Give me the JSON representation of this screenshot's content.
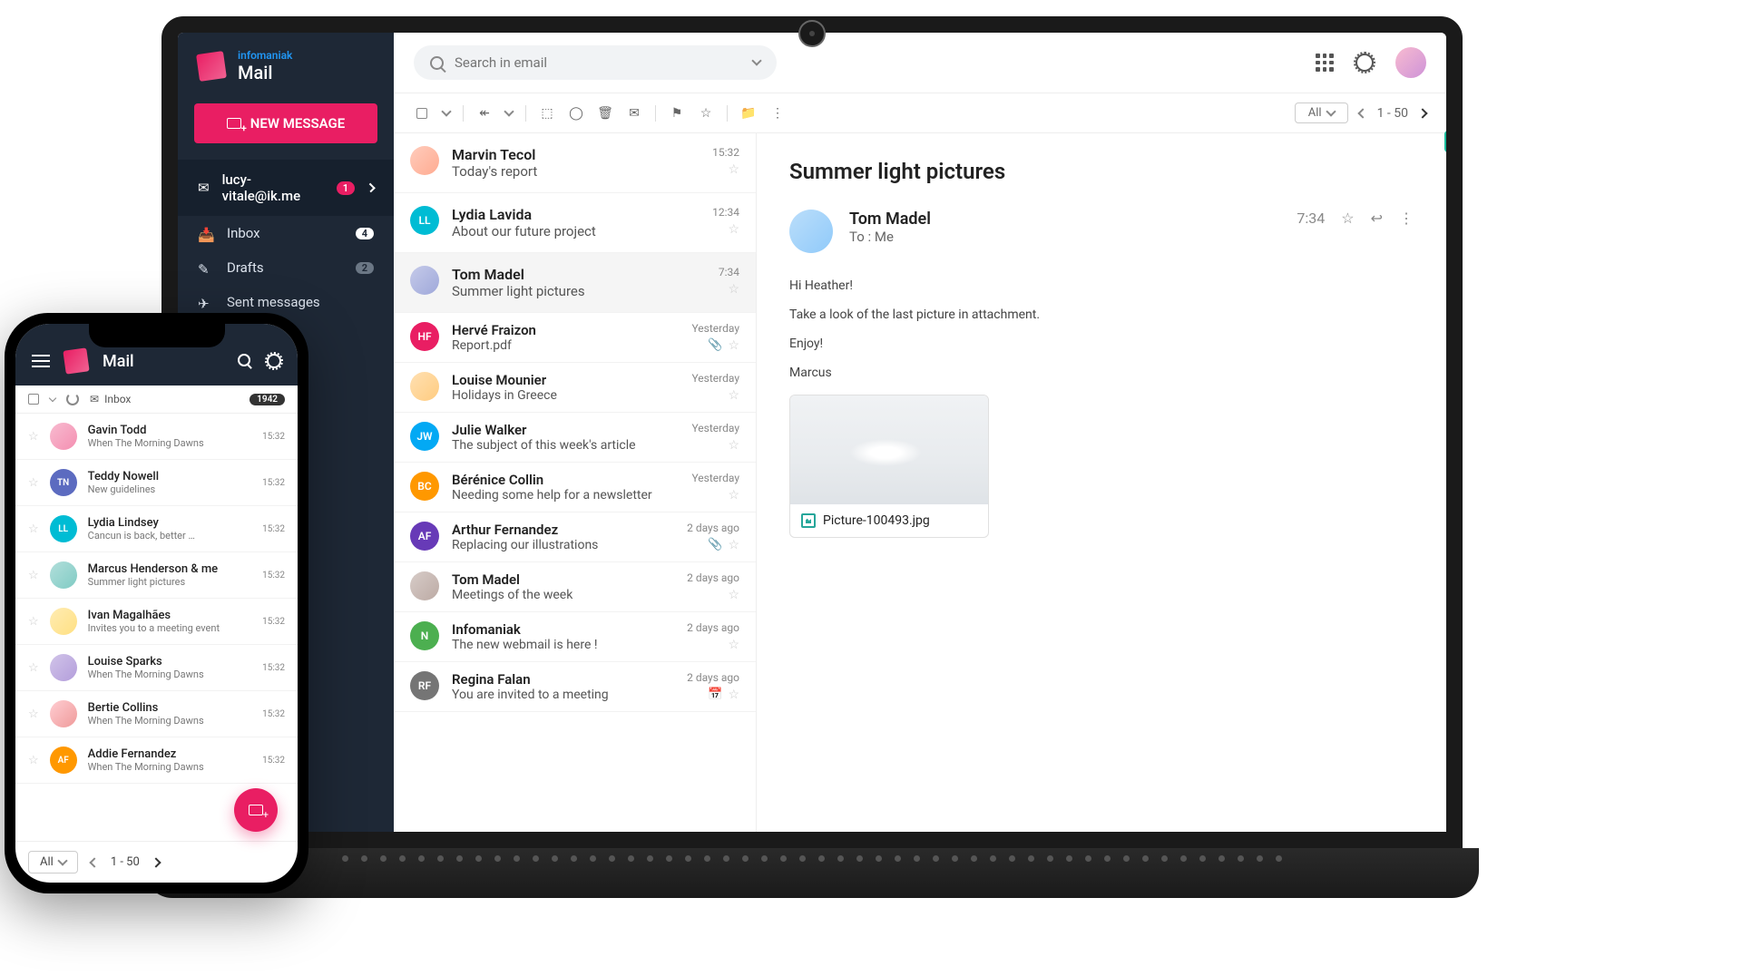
{
  "brand": {
    "company": "infomaniak",
    "product": "Mail"
  },
  "search": {
    "placeholder": "Search in email"
  },
  "sidebar": {
    "new_message": "NEW MESSAGE",
    "account": "lucy-vitale@ik.me",
    "account_badge": "1",
    "items": [
      {
        "label": "Inbox",
        "badge": "4"
      },
      {
        "label": "Drafts",
        "badge": "2"
      },
      {
        "label": "Sent messages"
      }
    ]
  },
  "toolbar": {
    "all": "All",
    "range": "1 - 50"
  },
  "emails": [
    {
      "sender": "Marvin Tecol",
      "subject": "Today's report",
      "time": "15:32",
      "initials": "",
      "avatar_class": "bg-photo1"
    },
    {
      "sender": "Lydia Lavida",
      "subject": "About our future project",
      "time": "12:34",
      "initials": "LL",
      "avatar_class": "bg-ll"
    },
    {
      "sender": "Tom Madel",
      "subject": "Summer light pictures",
      "time": "7:34",
      "initials": "",
      "avatar_class": "bg-photo2",
      "selected": true
    },
    {
      "sender": "Hervé Fraizon",
      "subject": "Report.pdf",
      "time": "Yesterday",
      "initials": "HF",
      "avatar_class": "bg-hf",
      "attachment": true
    },
    {
      "sender": "Louise Mounier",
      "subject": "Holidays in Greece",
      "time": "Yesterday",
      "initials": "",
      "avatar_class": "bg-photo3"
    },
    {
      "sender": "Julie Walker",
      "subject": "The subject of this week's article",
      "time": "Yesterday",
      "initials": "JW",
      "avatar_class": "bg-jw"
    },
    {
      "sender": "Bérénice Collin",
      "subject": "Needing some help for a newsletter",
      "time": "Yesterday",
      "initials": "BC",
      "avatar_class": "bg-bc"
    },
    {
      "sender": "Arthur Fernandez",
      "subject": "Replacing our illustrations",
      "time": "2 days ago",
      "initials": "AF",
      "avatar_class": "bg-af",
      "attachment": true
    },
    {
      "sender": "Tom Madel",
      "subject": "Meetings of the week",
      "time": "2 days ago",
      "initials": "",
      "avatar_class": "bg-photo4"
    },
    {
      "sender": "Infomaniak",
      "subject": "The new webmail is here !",
      "time": "2 days ago",
      "initials": "N",
      "avatar_class": "bg-n"
    },
    {
      "sender": "Regina Falan",
      "subject": "You are invited to a meeting",
      "time": "2 days ago",
      "initials": "RF",
      "avatar_class": "bg-rf",
      "calendar": true
    }
  ],
  "reader": {
    "subject": "Summer light pictures",
    "sender": "Tom Madel",
    "to": "To : Me",
    "time": "7:34",
    "body": [
      "Hi Heather!",
      "Take a look of the last picture in attachment.",
      "Enjoy!",
      "Marcus"
    ],
    "attachment_name": "Picture-100493.jpg"
  },
  "mobile": {
    "brand": "Mail",
    "inbox_label": "Inbox",
    "inbox_badge": "1942",
    "footer_all": "All",
    "footer_range": "1 - 50",
    "emails": [
      {
        "sender": "Gavin Todd",
        "subject": "When The Morning Dawns",
        "time": "15:32",
        "initials": "",
        "avatar_class": "bg-photo5"
      },
      {
        "sender": "Teddy Nowell",
        "subject": "New guidelines",
        "time": "15:32",
        "initials": "TN",
        "avatar_class": "bg-tn"
      },
      {
        "sender": "Lydia Lindsey",
        "subject": "Cancun is back, better …",
        "time": "15:32",
        "initials": "LL",
        "avatar_class": "bg-ll"
      },
      {
        "sender": "Marcus Henderson & me",
        "subject": "Summer light pictures",
        "time": "15:32",
        "initials": "",
        "avatar_class": "bg-photo6"
      },
      {
        "sender": "Ivan Magalhães",
        "subject": "Invites you to a meeting event",
        "time": "15:32",
        "initials": "",
        "avatar_class": "bg-photo7"
      },
      {
        "sender": "Louise Sparks",
        "subject": "When The Morning Dawns",
        "time": "15:32",
        "initials": "",
        "avatar_class": "bg-photo8"
      },
      {
        "sender": "Bertie Collins",
        "subject": "When The Morning Dawns",
        "time": "15:32",
        "initials": "",
        "avatar_class": "bg-photo9"
      },
      {
        "sender": "Addie Fernandez",
        "subject": "When The Morning Dawns",
        "time": "15:32",
        "initials": "AF",
        "avatar_class": "bg-bc"
      }
    ]
  }
}
